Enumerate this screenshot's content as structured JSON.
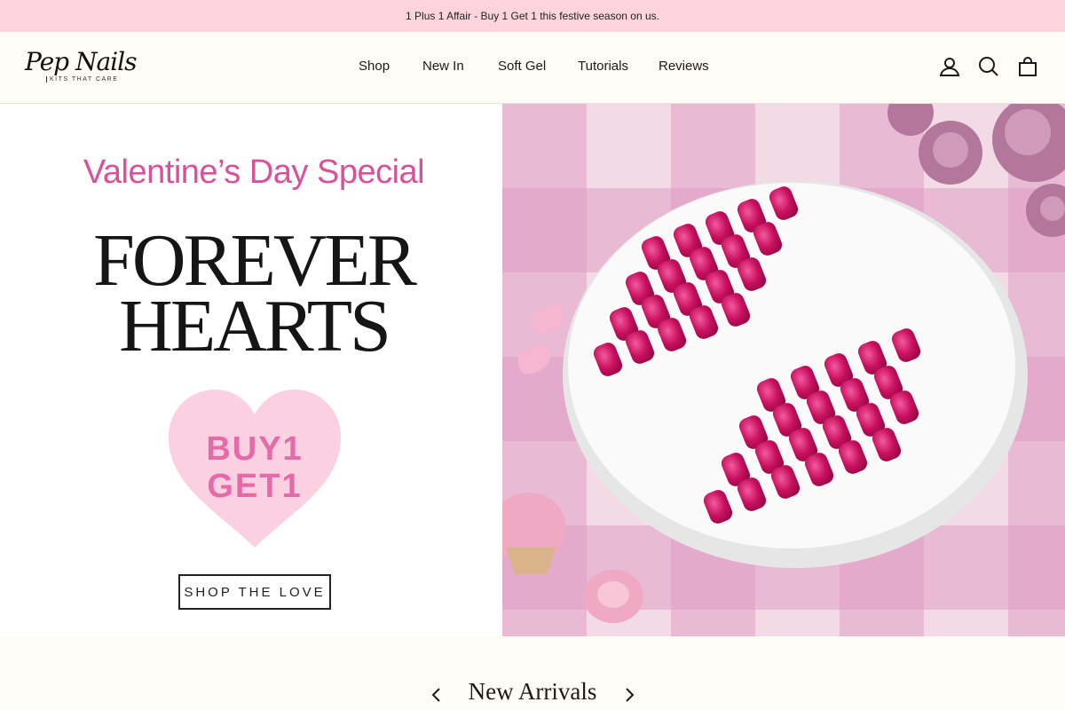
{
  "announcement": "1 Plus 1 Affair - Buy 1 Get 1 this festive season on us.",
  "logo": {
    "script": "Pep Nails",
    "tagline": "KITS THAT CARE"
  },
  "nav": [
    "Shop",
    "New In",
    "Soft Gel",
    "Tutorials",
    "Reviews"
  ],
  "header_icons": [
    "account-icon",
    "search-icon",
    "cart-icon"
  ],
  "hero": {
    "subtitle": "Valentine’s Day Special",
    "title_line1": "FOREVER",
    "title_line2": "HEARTS",
    "offer_line1": "BUY1",
    "offer_line2": "GET1",
    "cta": "SHOP THE LOVE"
  },
  "section": {
    "title": "New Arrivals"
  },
  "colors": {
    "announcement_bg": "#fcd4de",
    "accent_pink": "#d9519b",
    "nail_magenta": "#c8105e",
    "page_bg": "#fdfdf5"
  }
}
